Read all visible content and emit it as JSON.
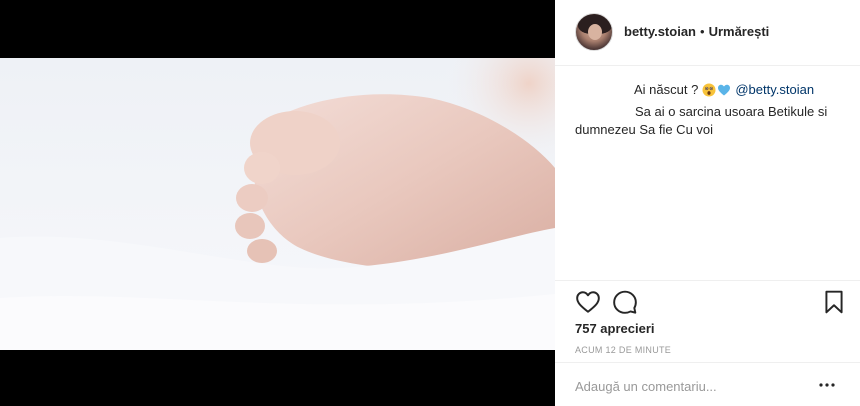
{
  "post": {
    "username": "betty.stoian",
    "separator": "•",
    "follow_label": "Urmărești"
  },
  "caption": {
    "question": "Ai născut ?",
    "mention": "@betty.stoian",
    "comment_text": "Sa ai o sarcina usoara Betikule si dumnezeu Sa fie Cu voi"
  },
  "stats": {
    "likes": "757 aprecieri",
    "time": "ACUM 12 DE MINUTE"
  },
  "comment_box": {
    "placeholder": "Adaugă un comentariu..."
  },
  "icons": {
    "like": "heart-icon",
    "comment": "comment-icon",
    "save": "bookmark-icon",
    "more": "more-icon"
  }
}
